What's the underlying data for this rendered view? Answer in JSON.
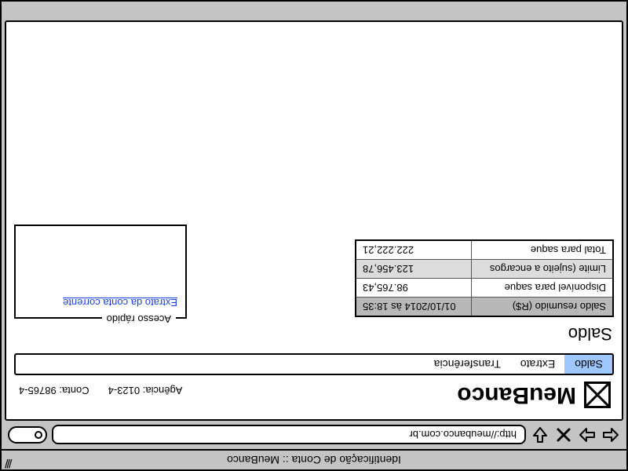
{
  "window_title": "Identificação de Conta :: MeuBanco",
  "url": "http://meubanco.com.br",
  "brand": "MeuBanco",
  "account": {
    "agencia_label": "Agência:",
    "agencia_value": "0123-4",
    "conta_label": "Conta:",
    "conta_value": "98765-4"
  },
  "tabs": {
    "saldo": "Saldo",
    "extrato": "Extrato",
    "transferencia": "Transferência"
  },
  "section_title": "Saldo",
  "balance": {
    "header_left": "Saldo resumido (R$)",
    "header_right": "01/10/2014 às 18:35",
    "rows": [
      {
        "label": "Disponível para saque",
        "value": "98.765,43"
      },
      {
        "label": "Limite (sujeito a encargos",
        "value": "123.456,78"
      },
      {
        "label": "Total para saque",
        "value": "222.222,21"
      }
    ]
  },
  "quick": {
    "legend": "Acesso rápido",
    "link": "Extrato da conta corrente"
  }
}
